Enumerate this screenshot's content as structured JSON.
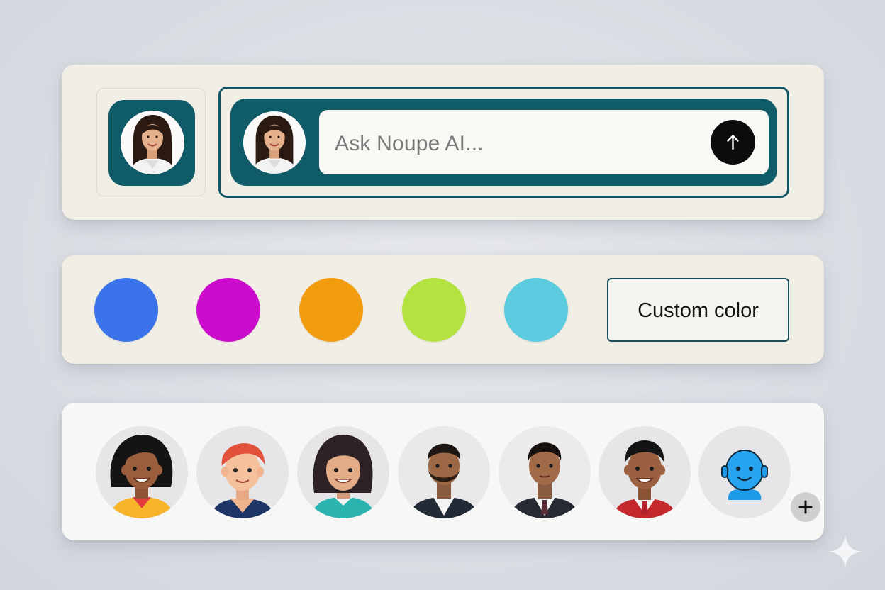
{
  "profile": {
    "avatar_icon": "user-photo-icon"
  },
  "chat": {
    "placeholder": "Ask Noupe AI...",
    "send_icon": "arrow-up-icon"
  },
  "colors": {
    "swatches": [
      "#3a73ea",
      "#cc0ccc",
      "#f29c10",
      "#b4e341",
      "#5ccbdf"
    ],
    "custom_label": "Custom color"
  },
  "avatars": {
    "items": [
      "woman-avatar-icon",
      "redhead-avatar-icon",
      "woman-bob-avatar-icon",
      "man-photo-avatar-icon",
      "man-suit-avatar-icon",
      "man-red-jacket-avatar-icon",
      "bot-avatar-icon"
    ],
    "add_icon": "plus-icon"
  },
  "accent": "#0f5b68"
}
